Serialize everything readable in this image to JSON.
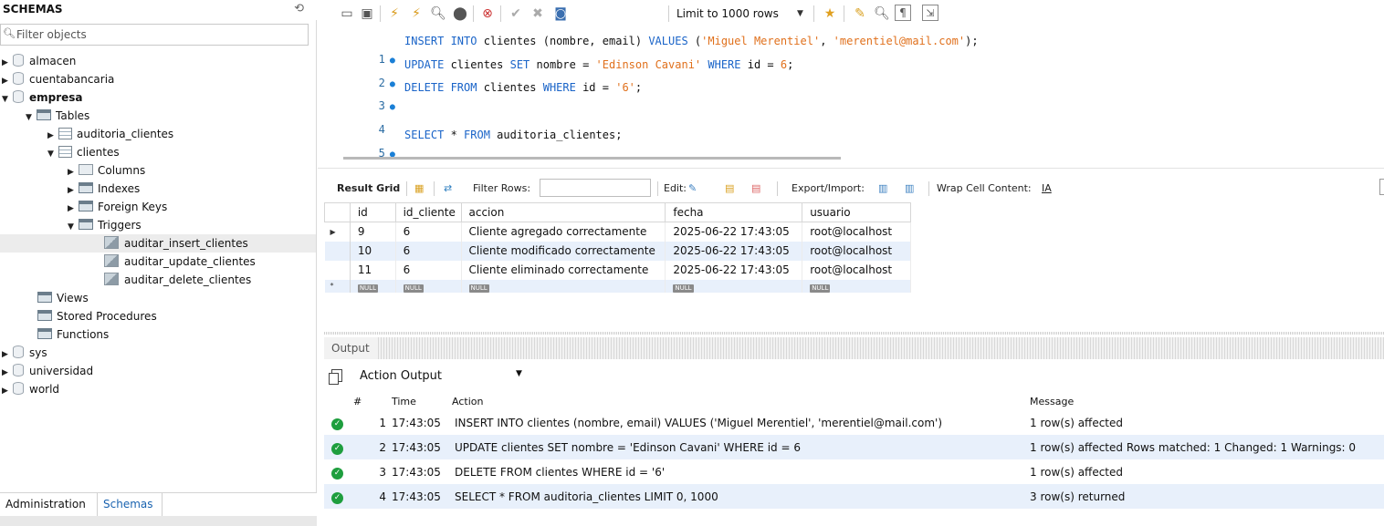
{
  "schemas_panel": {
    "title": "SCHEMAS",
    "filter_placeholder": "Filter objects",
    "tree": {
      "almacen": "almacen",
      "cuentabancaria": "cuentabancaria",
      "empresa": "empresa",
      "tables": "Tables",
      "auditoria_clientes": "auditoria_clientes",
      "clientes": "clientes",
      "columns": "Columns",
      "indexes": "Indexes",
      "foreign_keys": "Foreign Keys",
      "triggers": "Triggers",
      "trigger_1": "auditar_insert_clientes",
      "trigger_2": "auditar_update_clientes",
      "trigger_3": "auditar_delete_clientes",
      "views": "Views",
      "stored_procedures": "Stored Procedures",
      "functions": "Functions",
      "sys": "sys",
      "universidad": "universidad",
      "world": "world"
    },
    "tabs": {
      "administration": "Administration",
      "schemas": "Schemas"
    }
  },
  "toolbar": {
    "limit_label": "Limit to 1000 rows"
  },
  "editor": {
    "lines": [
      {
        "num": "1",
        "dot": "●"
      },
      {
        "num": "2",
        "dot": "●"
      },
      {
        "num": "3",
        "dot": "●"
      },
      {
        "num": "4",
        "dot": ""
      },
      {
        "num": "5",
        "dot": "●"
      }
    ],
    "l1": {
      "k1": "INSERT INTO",
      "t1": " clientes (nombre, email) ",
      "k2": "VALUES",
      "t2": " (",
      "s1": "'Miguel Merentiel'",
      "t3": ", ",
      "s2": "'merentiel@mail.com'",
      "t4": ");"
    },
    "l2": {
      "k1": "UPDATE",
      "t1": " clientes ",
      "k2": "SET",
      "t2": " nombre = ",
      "s1": "'Edinson Cavani'",
      "t3": " ",
      "k3": "WHERE",
      "t4": " id = ",
      "n1": "6",
      "t5": ";"
    },
    "l3": {
      "k1": "DELETE FROM",
      "t1": " clientes ",
      "k2": "WHERE",
      "t2": " id = ",
      "s1": "'6'",
      "t3": ";"
    },
    "l5": {
      "k1": "SELECT",
      "t1": " * ",
      "k2": "FROM",
      "t2": " auditoria_clientes;"
    }
  },
  "result_toolbar": {
    "result_grid": "Result Grid",
    "filter_rows": "Filter Rows:",
    "edit": "Edit:",
    "export_import": "Export/Import:",
    "wrap_cell": "Wrap Cell Content:"
  },
  "result_grid": {
    "columns": [
      "id",
      "id_cliente",
      "accion",
      "fecha",
      "usuario"
    ],
    "rows": [
      [
        "9",
        "6",
        "Cliente agregado correctamente",
        "2025-06-22 17:43:05",
        "root@localhost"
      ],
      [
        "10",
        "6",
        "Cliente modificado correctamente",
        "2025-06-22 17:43:05",
        "root@localhost"
      ],
      [
        "11",
        "6",
        "Cliente eliminado correctamente",
        "2025-06-22 17:43:05",
        "root@localhost"
      ]
    ],
    "null_label": "NULL",
    "new_row_marker": "*",
    "current_row_marker": "▶"
  },
  "output": {
    "title": "Output",
    "selector": "Action Output",
    "columns": {
      "num": "#",
      "time": "Time",
      "action": "Action",
      "message": "Message"
    },
    "rows": [
      {
        "num": "1",
        "time": "17:43:05",
        "action": "INSERT INTO clientes (nombre, email) VALUES ('Miguel Merentiel', 'merentiel@mail.com')",
        "message": "1 row(s) affected"
      },
      {
        "num": "2",
        "time": "17:43:05",
        "action": "UPDATE clientes SET nombre = 'Edinson Cavani' WHERE id = 6",
        "message": "1 row(s) affected Rows matched: 1  Changed: 1  Warnings: 0"
      },
      {
        "num": "3",
        "time": "17:43:05",
        "action": "DELETE FROM clientes WHERE id = '6'",
        "message": "1 row(s) affected"
      },
      {
        "num": "4",
        "time": "17:43:05",
        "action": "SELECT * FROM auditoria_clientes LIMIT 0, 1000",
        "message": "3 row(s) returned"
      }
    ]
  },
  "colors": {
    "keyword": "#1a64c8",
    "string": "#e0701c",
    "row_alt": "#e8f0fb",
    "success": "#1e9e3e",
    "schemas_tab": "#1a63b0"
  }
}
